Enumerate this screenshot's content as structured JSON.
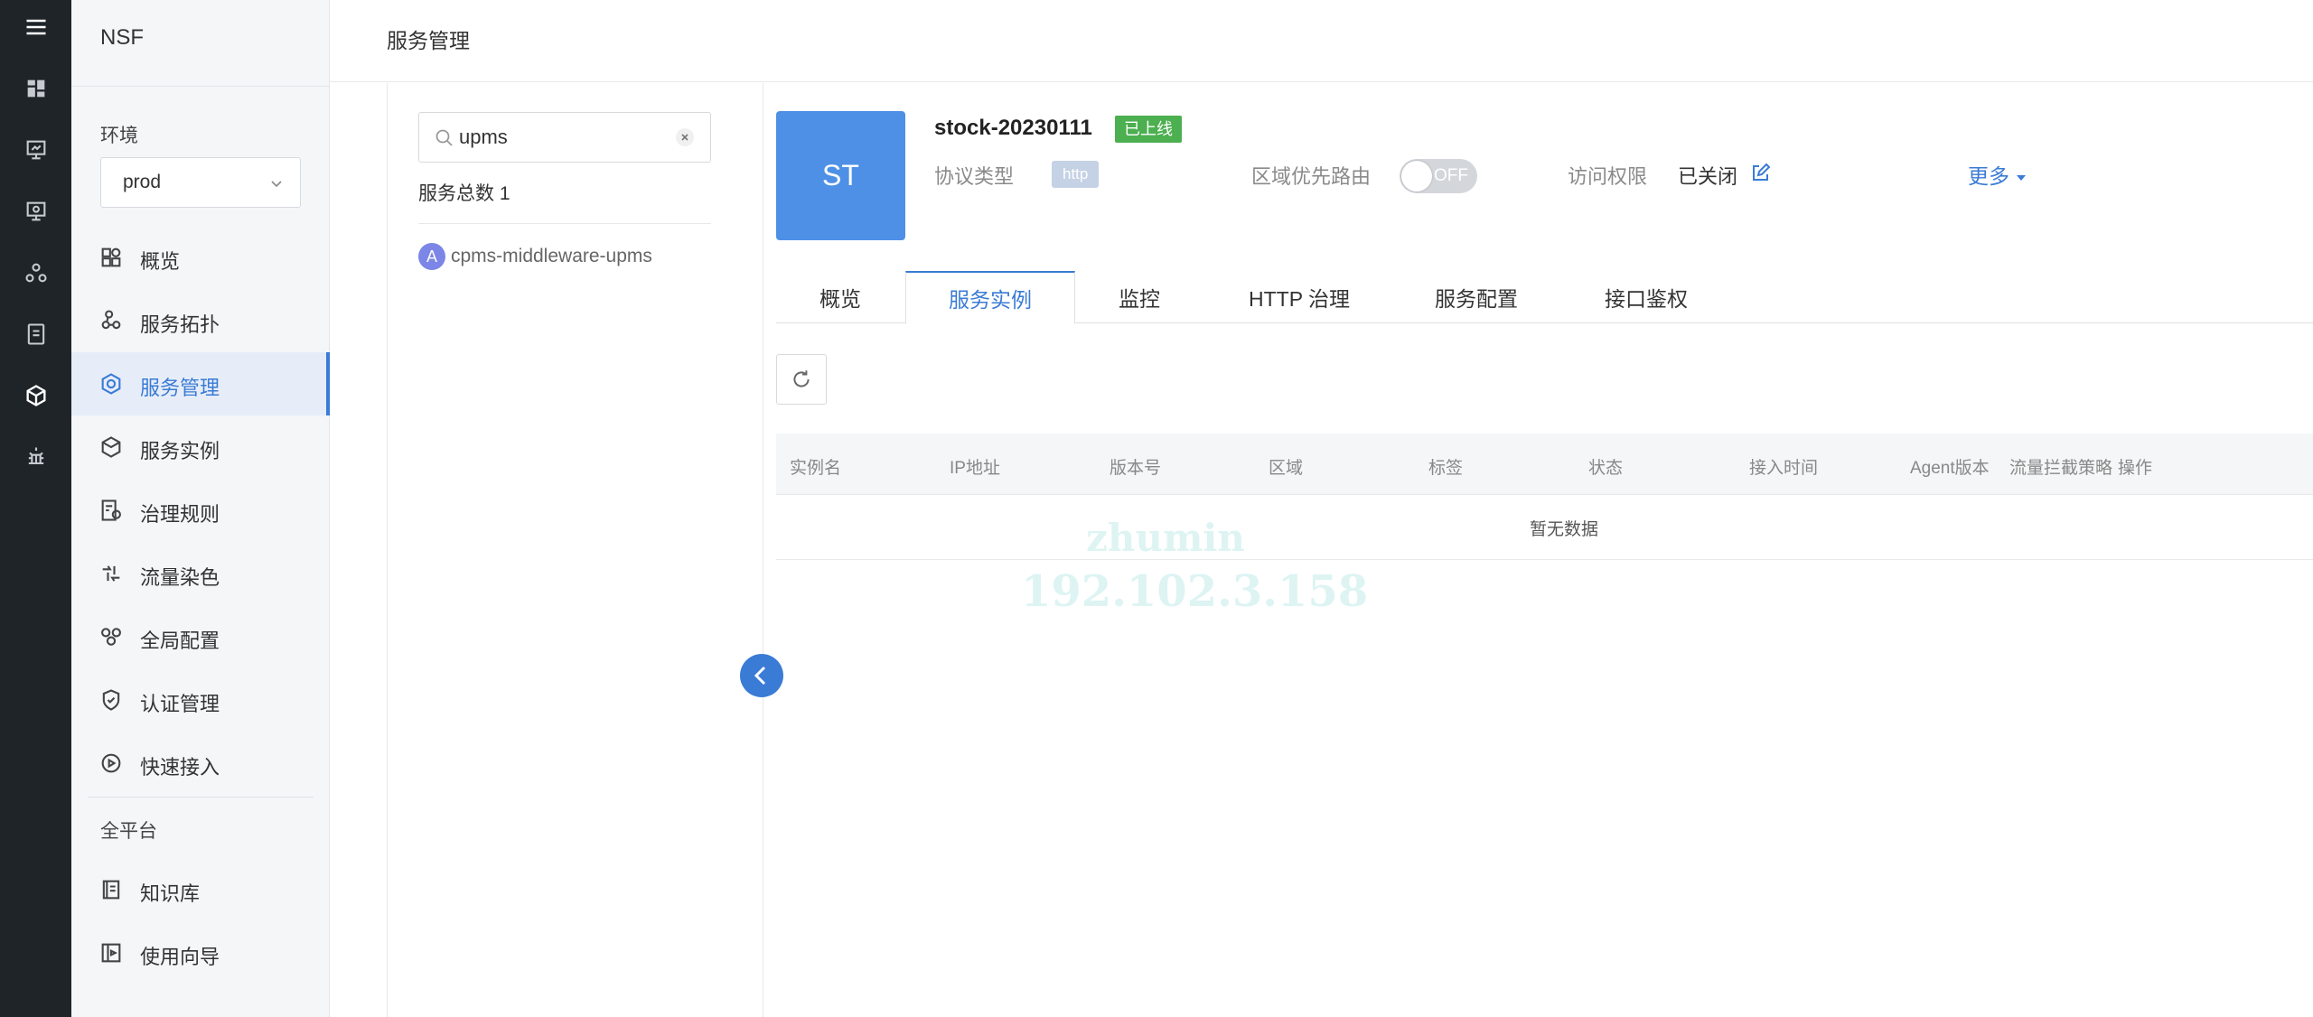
{
  "sidebar": {
    "title": "NSF",
    "env_label": "环境",
    "env_value": "prod",
    "nav": [
      {
        "label": "概览",
        "icon": "dashboard-icon"
      },
      {
        "label": "服务拓扑",
        "icon": "topology-icon"
      },
      {
        "label": "服务管理",
        "icon": "service-management-icon",
        "active": true
      },
      {
        "label": "服务实例",
        "icon": "cube-icon"
      },
      {
        "label": "治理规则",
        "icon": "rules-icon"
      },
      {
        "label": "流量染色",
        "icon": "traffic-icon"
      },
      {
        "label": "全局配置",
        "icon": "global-config-icon"
      },
      {
        "label": "认证管理",
        "icon": "shield-icon"
      },
      {
        "label": "快速接入",
        "icon": "quick-access-icon"
      }
    ],
    "section_label": "全平台",
    "platform_nav": [
      {
        "label": "知识库",
        "icon": "book-icon"
      },
      {
        "label": "使用向导",
        "icon": "guide-icon"
      }
    ]
  },
  "page": {
    "title": "服务管理"
  },
  "service_list": {
    "search_value": "upms",
    "total": "服务总数 1",
    "items": [
      {
        "badge": "A",
        "name": "cpms-middleware-upms"
      }
    ]
  },
  "service": {
    "avatar": "ST",
    "name": "stock-20230111",
    "status": "已上线",
    "protocol_label": "协议类型",
    "protocol_value": "http",
    "region_route_label": "区域优先路由",
    "region_route_toggle": "OFF",
    "access_label": "访问权限",
    "access_value": "已关闭",
    "more": "更多"
  },
  "tabs": [
    "概览",
    "服务实例",
    "监控",
    "HTTP 治理",
    "服务配置",
    "接口鉴权"
  ],
  "active_tab": "服务实例",
  "table": {
    "columns": [
      "实例名",
      "IP地址",
      "版本号",
      "区域",
      "标签",
      "状态",
      "接入时间",
      "Agent版本",
      "流量拦截策略",
      "操作"
    ],
    "empty": "暂无数据"
  },
  "watermark": [
    "zhumin",
    "192.102.3.158"
  ],
  "colors": {
    "accent": "#3a7bd5",
    "rail": "#1f2429",
    "status_online": "#4caf50",
    "avatar": "#4d90e6"
  }
}
